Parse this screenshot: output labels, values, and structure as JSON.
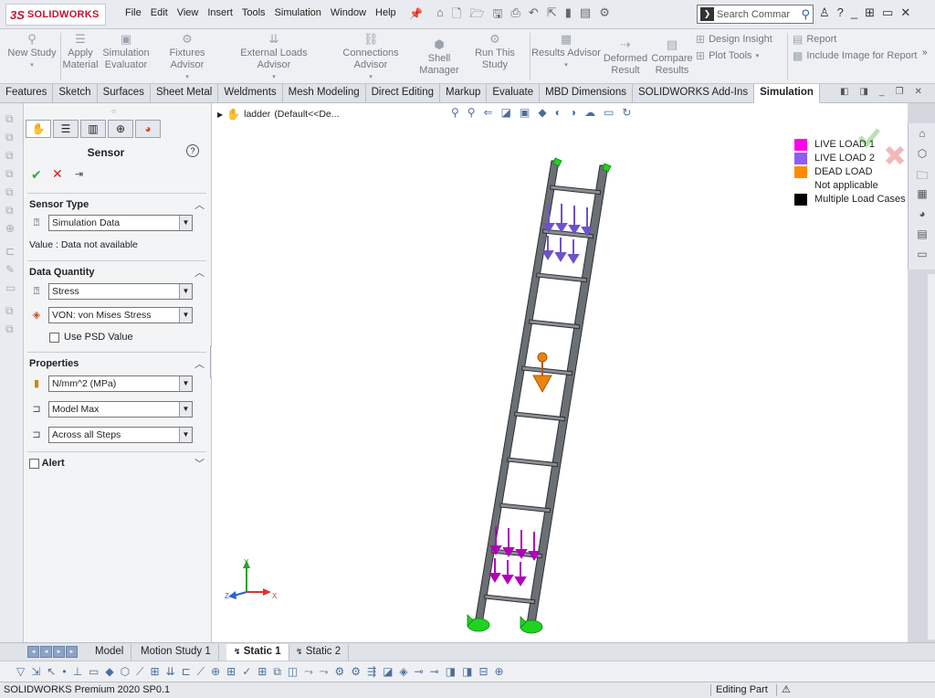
{
  "app": {
    "logo_ds": "3S",
    "logo_text": "SOLIDWORKS",
    "menus": [
      "File",
      "Edit",
      "View",
      "Insert",
      "Tools",
      "Simulation",
      "Window",
      "Help"
    ],
    "search_placeholder": "Search Commar"
  },
  "ribbon": {
    "commands": [
      {
        "label1": "New Study",
        "label2": "",
        "icon": "new-study-icon"
      },
      {
        "label1": "Apply",
        "label2": "Material",
        "icon": "apply-material-icon"
      },
      {
        "label1": "Simulation",
        "label2": "Evaluator",
        "icon": "simulation-evaluator-icon"
      },
      {
        "label1": "Fixtures Advisor",
        "label2": "",
        "icon": "fixtures-advisor-icon"
      },
      {
        "label1": "External Loads Advisor",
        "label2": "",
        "icon": "external-loads-icon"
      },
      {
        "label1": "Connections Advisor",
        "label2": "",
        "icon": "connections-advisor-icon"
      },
      {
        "label1": "Shell",
        "label2": "Manager",
        "icon": "shell-manager-icon"
      },
      {
        "label1": "Run This Study",
        "label2": "",
        "icon": "run-study-icon"
      },
      {
        "label1": "Results Advisor",
        "label2": "",
        "icon": "results-advisor-icon"
      },
      {
        "label1": "Deformed",
        "label2": "Result",
        "icon": "deformed-result-icon"
      },
      {
        "label1": "Compare",
        "label2": "Results",
        "icon": "compare-results-icon"
      }
    ],
    "side": {
      "design_insight": "Design Insight",
      "plot_tools": "Plot Tools",
      "report": "Report",
      "include_image": "Include Image for Report"
    }
  },
  "tabs": [
    "Features",
    "Sketch",
    "Surfaces",
    "Sheet Metal",
    "Weldments",
    "Mesh Modeling",
    "Direct Editing",
    "Markup",
    "Evaluate",
    "MBD Dimensions",
    "SOLIDWORKS Add-Ins",
    "Simulation"
  ],
  "active_tab": "Simulation",
  "property_manager": {
    "title": "Sensor",
    "sensor_type_header": "Sensor Type",
    "sensor_type": "Simulation Data",
    "value_text": "Value : Data not available",
    "data_quantity_header": "Data Quantity",
    "quantity": "Stress",
    "component": "VON: von Mises Stress",
    "use_psd": "Use PSD Value",
    "properties_header": "Properties",
    "units": "N/mm^2 (MPa)",
    "criterion": "Model Max",
    "step_criterion": "Across all Steps",
    "alert_label": "Alert"
  },
  "graphics": {
    "tree_item": "ladder",
    "tree_config": "(Default<<De...",
    "legend": [
      {
        "label": "LIVE LOAD 1",
        "color": "#ff00e6"
      },
      {
        "label": "LIVE LOAD 2",
        "color": "#8f5cf5"
      },
      {
        "label": "DEAD LOAD",
        "color": "#ff8a00"
      },
      {
        "label": "Not applicable",
        "color": ""
      },
      {
        "label": "Multiple Load Cases",
        "color": "#000000"
      }
    ],
    "triad": {
      "x": "X",
      "y": "Y",
      "z": "Z"
    }
  },
  "bottom_tabs": [
    "Model",
    "Motion Study 1",
    "Static 1",
    "Static 2"
  ],
  "active_bottom_tab": "Static 1",
  "status": {
    "left": "SOLIDWORKS Premium 2020 SP0.1",
    "right": "Editing Part"
  }
}
